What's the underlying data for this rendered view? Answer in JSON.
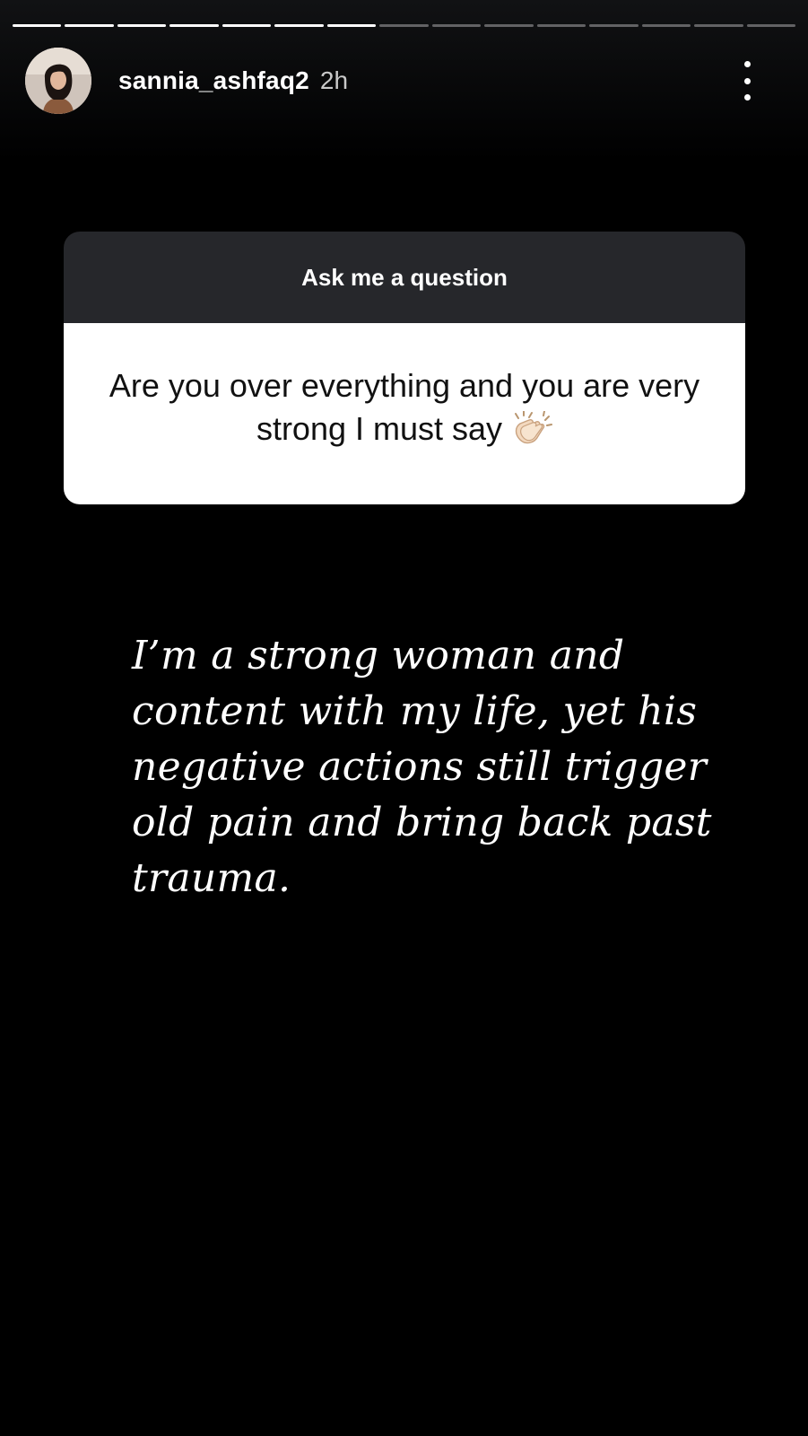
{
  "story": {
    "progress": {
      "total_segments": 15,
      "seen_segments": 7
    },
    "header": {
      "username": "sannia_ashfaq2",
      "timestamp": "2h",
      "more_icon": "more-vertical-icon"
    },
    "question_sticker": {
      "title": "Ask me a question",
      "question": "Are you over everything and you are very strong I must say",
      "emoji": "clapping-hands-icon"
    },
    "answer": "I’m a strong woman and content with my life, yet his negative actions still trigger old pain and bring back past trauma."
  },
  "colors": {
    "background": "#000000",
    "sticker_header": "#26272b",
    "sticker_body": "#ffffff",
    "progress_seen": "#ffffff",
    "progress_unseen": "rgba(255,255,255,0.35)"
  }
}
